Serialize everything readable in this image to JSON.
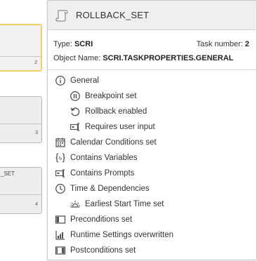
{
  "background": {
    "tasks": [
      {
        "number": "2",
        "name": ""
      },
      {
        "number": "3",
        "name": ""
      },
      {
        "number": "4",
        "name": "_SET"
      }
    ]
  },
  "tooltip": {
    "title": "ROLLBACK_SET",
    "type_label": "Type:",
    "type_value": "SCRI",
    "task_number_label": "Task number:",
    "task_number_value": "2",
    "object_name_label": "Object Name:",
    "object_name_value": "SCRI.TASKPROPERTIES.GENERAL",
    "items": [
      {
        "label": "General",
        "icon": "info-icon"
      },
      {
        "label": "Breakpoint set",
        "icon": "pause-icon"
      },
      {
        "label": "Rollback enabled",
        "icon": "rollback-icon"
      },
      {
        "label": "Requires user input",
        "icon": "user-input-icon"
      },
      {
        "label": "Calendar Conditions set",
        "icon": "calendar-icon"
      },
      {
        "label": "Contains Variables",
        "icon": "variables-icon"
      },
      {
        "label": "Contains Prompts",
        "icon": "prompts-icon"
      },
      {
        "label": "Time & Dependencies",
        "icon": "clock-icon"
      },
      {
        "label": "Earliest Start Time set",
        "icon": "sunrise-icon"
      },
      {
        "label": "Preconditions set",
        "icon": "preconditions-icon"
      },
      {
        "label": "Runtime Settings overwritten",
        "icon": "runtime-settings-icon"
      },
      {
        "label": "Postconditions set",
        "icon": "postconditions-icon"
      }
    ]
  }
}
